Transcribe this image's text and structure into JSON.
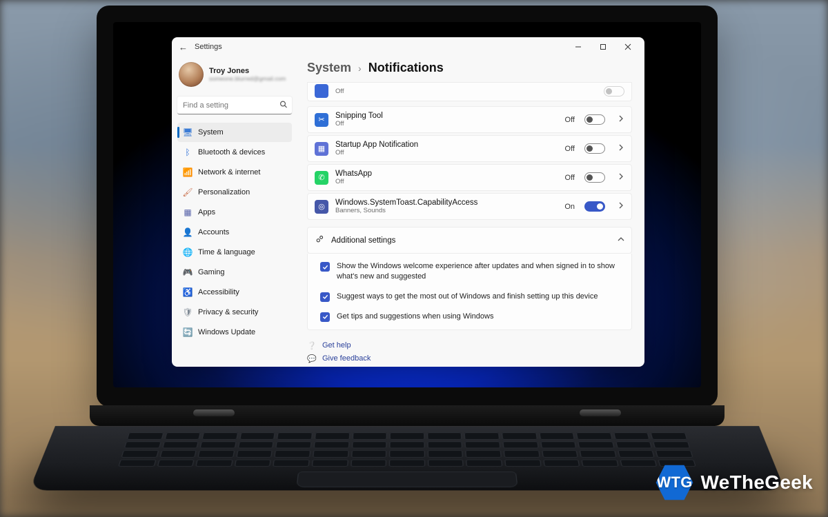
{
  "window_title": "Settings",
  "profile": {
    "name": "Troy Jones",
    "email": "someone.blurred@gmail.com"
  },
  "search": {
    "placeholder": "Find a setting"
  },
  "sidebar": {
    "items": [
      {
        "label": "System",
        "icon": "display-icon",
        "color": "#3a7bd5",
        "glyph": "🖥"
      },
      {
        "label": "Bluetooth & devices",
        "icon": "bluetooth-icon",
        "color": "#2e6fd6",
        "glyph": "ᛒ"
      },
      {
        "label": "Network & internet",
        "icon": "wifi-icon",
        "color": "#19b5d4",
        "glyph": "📶"
      },
      {
        "label": "Personalization",
        "icon": "brush-icon",
        "color": "#c96e4a",
        "glyph": "🖌"
      },
      {
        "label": "Apps",
        "icon": "apps-icon",
        "color": "#5560a8",
        "glyph": "▦"
      },
      {
        "label": "Accounts",
        "icon": "account-icon",
        "color": "#8f9aa5",
        "glyph": "👤"
      },
      {
        "label": "Time & language",
        "icon": "globe-icon",
        "color": "#3aa0c9",
        "glyph": "🌐"
      },
      {
        "label": "Gaming",
        "icon": "gaming-icon",
        "color": "#6fa54b",
        "glyph": "🎮"
      },
      {
        "label": "Accessibility",
        "icon": "accessibility-icon",
        "color": "#4a6fbf",
        "glyph": "♿"
      },
      {
        "label": "Privacy & security",
        "icon": "shield-icon",
        "color": "#7f8994",
        "glyph": "🛡"
      },
      {
        "label": "Windows Update",
        "icon": "update-icon",
        "color": "#1f8ad6",
        "glyph": "🔄"
      }
    ],
    "active_index": 0
  },
  "breadcrumb": {
    "parent": "System",
    "current": "Notifications"
  },
  "truncated_row": {
    "sub": "Off"
  },
  "on_label": "On",
  "off_label": "Off",
  "apps": [
    {
      "title": "Snipping Tool",
      "sub": "Off",
      "state": "Off",
      "on": false,
      "icon_bg": "#2f6fd6",
      "glyph": "✂"
    },
    {
      "title": "Startup App Notification",
      "sub": "Off",
      "state": "Off",
      "on": false,
      "icon_bg": "#5f72d6",
      "glyph": "▦"
    },
    {
      "title": "WhatsApp",
      "sub": "Off",
      "state": "Off",
      "on": false,
      "icon_bg": "#25D366",
      "glyph": "✆"
    },
    {
      "title": "Windows.SystemToast.CapabilityAccess",
      "sub": "Banners, Sounds",
      "state": "On",
      "on": true,
      "icon_bg": "#4557a8",
      "glyph": "◎"
    }
  ],
  "additional": {
    "header": "Additional settings",
    "checks": [
      "Show the Windows welcome experience after updates and when signed in to show what's new and suggested",
      "Suggest ways to get the most out of Windows and finish setting up this device",
      "Get tips and suggestions when using Windows"
    ]
  },
  "footer": {
    "help": "Get help",
    "feedback": "Give feedback"
  },
  "brand": {
    "logo": "WTG",
    "name": "WeTheGeek"
  }
}
